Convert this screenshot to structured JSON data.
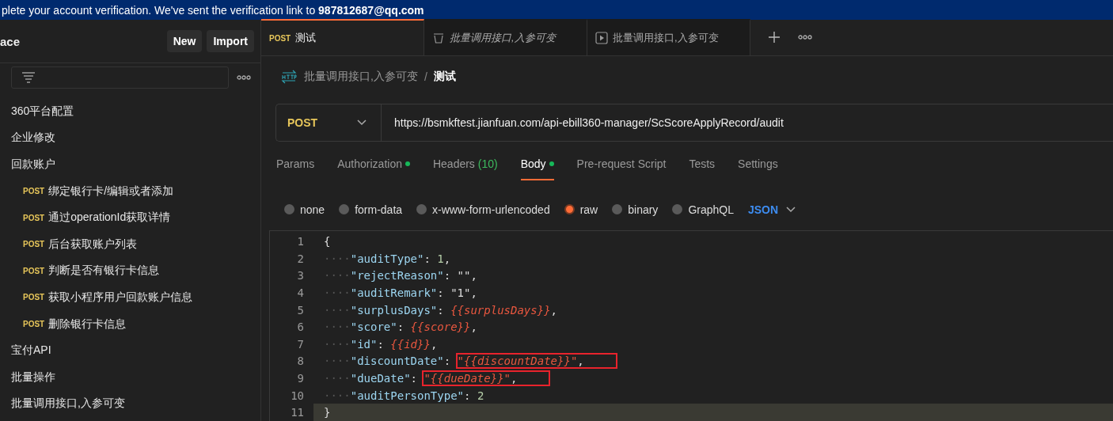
{
  "banner": {
    "text": "plete your account verification. We've sent the verification link to **987812687@qq.com**"
  },
  "sidebar": {
    "title": "ace",
    "buttons": [
      "New",
      "Import"
    ],
    "items": [
      {
        "kind": "folder",
        "label": "360平台配置"
      },
      {
        "kind": "folder",
        "label": "企业修改"
      },
      {
        "kind": "folder",
        "label": "回款账户",
        "children": [
          {
            "kind": "request",
            "method": "POST",
            "label": "绑定银行卡/编辑或者添加"
          },
          {
            "kind": "request",
            "method": "POST",
            "label": "通过operationId获取详情"
          },
          {
            "kind": "request",
            "method": "POST",
            "label": "后台获取账户列表"
          },
          {
            "kind": "request",
            "method": "POST",
            "label": "判断是否有银行卡信息"
          },
          {
            "kind": "request",
            "method": "POST",
            "label": "获取小程序用户回款账户信息"
          },
          {
            "kind": "request",
            "method": "POST",
            "label": "删除银行卡信息"
          }
        ]
      },
      {
        "kind": "folder",
        "label": "宝付API"
      },
      {
        "kind": "folder",
        "label": "批量操作"
      },
      {
        "kind": "folder",
        "label": "批量调用接口,入参可变"
      }
    ]
  },
  "tabs": [
    {
      "kind": "request",
      "method": "POST",
      "label": "测试",
      "selected": true
    },
    {
      "kind": "preview",
      "label": "批量调用接口,入参可变",
      "selected": false
    },
    {
      "kind": "runner",
      "label": "批量调用接口,入参可变",
      "selected": false
    }
  ],
  "breadcrumb": {
    "parent": "批量调用接口,入参可变",
    "separator": "/",
    "current": "测试"
  },
  "request": {
    "method": "POST",
    "url": "https://bsmkftest.jianfuan.com/api-ebill360-manager/ScScoreApplyRecord/audit"
  },
  "request_tabs": [
    {
      "label": "Params",
      "selected": false,
      "dot": false
    },
    {
      "label": "Authorization",
      "selected": false,
      "dot": true
    },
    {
      "label": "Headers",
      "count": "(10)",
      "selected": false,
      "dot": false
    },
    {
      "label": "Body",
      "selected": true,
      "dot": true
    },
    {
      "label": "Pre-request Script",
      "selected": false,
      "dot": false
    },
    {
      "label": "Tests",
      "selected": false,
      "dot": false
    },
    {
      "label": "Settings",
      "selected": false,
      "dot": false
    }
  ],
  "body_types": [
    {
      "label": "none",
      "selected": false
    },
    {
      "label": "form-data",
      "selected": false
    },
    {
      "label": "x-www-form-urlencoded",
      "selected": false
    },
    {
      "label": "raw",
      "selected": true
    },
    {
      "label": "binary",
      "selected": false
    },
    {
      "label": "GraphQL",
      "selected": false
    }
  ],
  "language": "JSON",
  "editor": {
    "lines": [
      {
        "number": "1",
        "kind": "brace",
        "text": "{",
        "current": false
      },
      {
        "number": "2",
        "kind": "pair",
        "indent": "····",
        "key": "\"auditType\"",
        "colon": ": ",
        "value": {
          "kind": "number",
          "text": "1"
        },
        "comma": ",",
        "boxed": false,
        "current": false
      },
      {
        "number": "3",
        "kind": "pair",
        "indent": "····",
        "key": "\"rejectReason\"",
        "colon": ": ",
        "value": {
          "kind": "string",
          "text": "\"\""
        },
        "comma": ",",
        "boxed": false,
        "current": false
      },
      {
        "number": "4",
        "kind": "pair",
        "indent": "····",
        "key": "\"auditRemark\"",
        "colon": ": ",
        "value": {
          "kind": "string",
          "text": "\"1\""
        },
        "comma": ",",
        "boxed": false,
        "current": false
      },
      {
        "number": "5",
        "kind": "pair",
        "indent": "····",
        "key": "\"surplusDays\"",
        "colon": ": ",
        "value": {
          "kind": "variable",
          "text": "{{surplusDays}}"
        },
        "comma": ",",
        "boxed": false,
        "current": false
      },
      {
        "number": "6",
        "kind": "pair",
        "indent": "····",
        "key": "\"score\"",
        "colon": ": ",
        "value": {
          "kind": "variable",
          "text": "{{score}}"
        },
        "comma": ",",
        "boxed": false,
        "current": false
      },
      {
        "number": "7",
        "kind": "pair",
        "indent": "····",
        "key": "\"id\"",
        "colon": ": ",
        "value": {
          "kind": "variable",
          "text": "{{id}}"
        },
        "comma": ",",
        "boxed": false,
        "current": false
      },
      {
        "number": "8",
        "kind": "pair",
        "indent": "····",
        "key": "\"discountDate\"",
        "colon": ": ",
        "value": {
          "kind": "quoted_variable",
          "text": "\"{{discountDate}}\""
        },
        "comma": ",",
        "boxed": true,
        "current": false
      },
      {
        "number": "9",
        "kind": "pair",
        "indent": "····",
        "key": "\"dueDate\"",
        "colon": ": ",
        "value": {
          "kind": "quoted_variable",
          "text": "\"{{dueDate}}\""
        },
        "comma": ",",
        "boxed": true,
        "current": false
      },
      {
        "number": "10",
        "kind": "pair",
        "indent": "····",
        "key": "\"auditPersonType\"",
        "colon": ": ",
        "value": {
          "kind": "number",
          "text": "2"
        },
        "boxed": false,
        "current": false
      },
      {
        "number": "11",
        "kind": "brace",
        "text": "}",
        "current": true
      }
    ]
  }
}
